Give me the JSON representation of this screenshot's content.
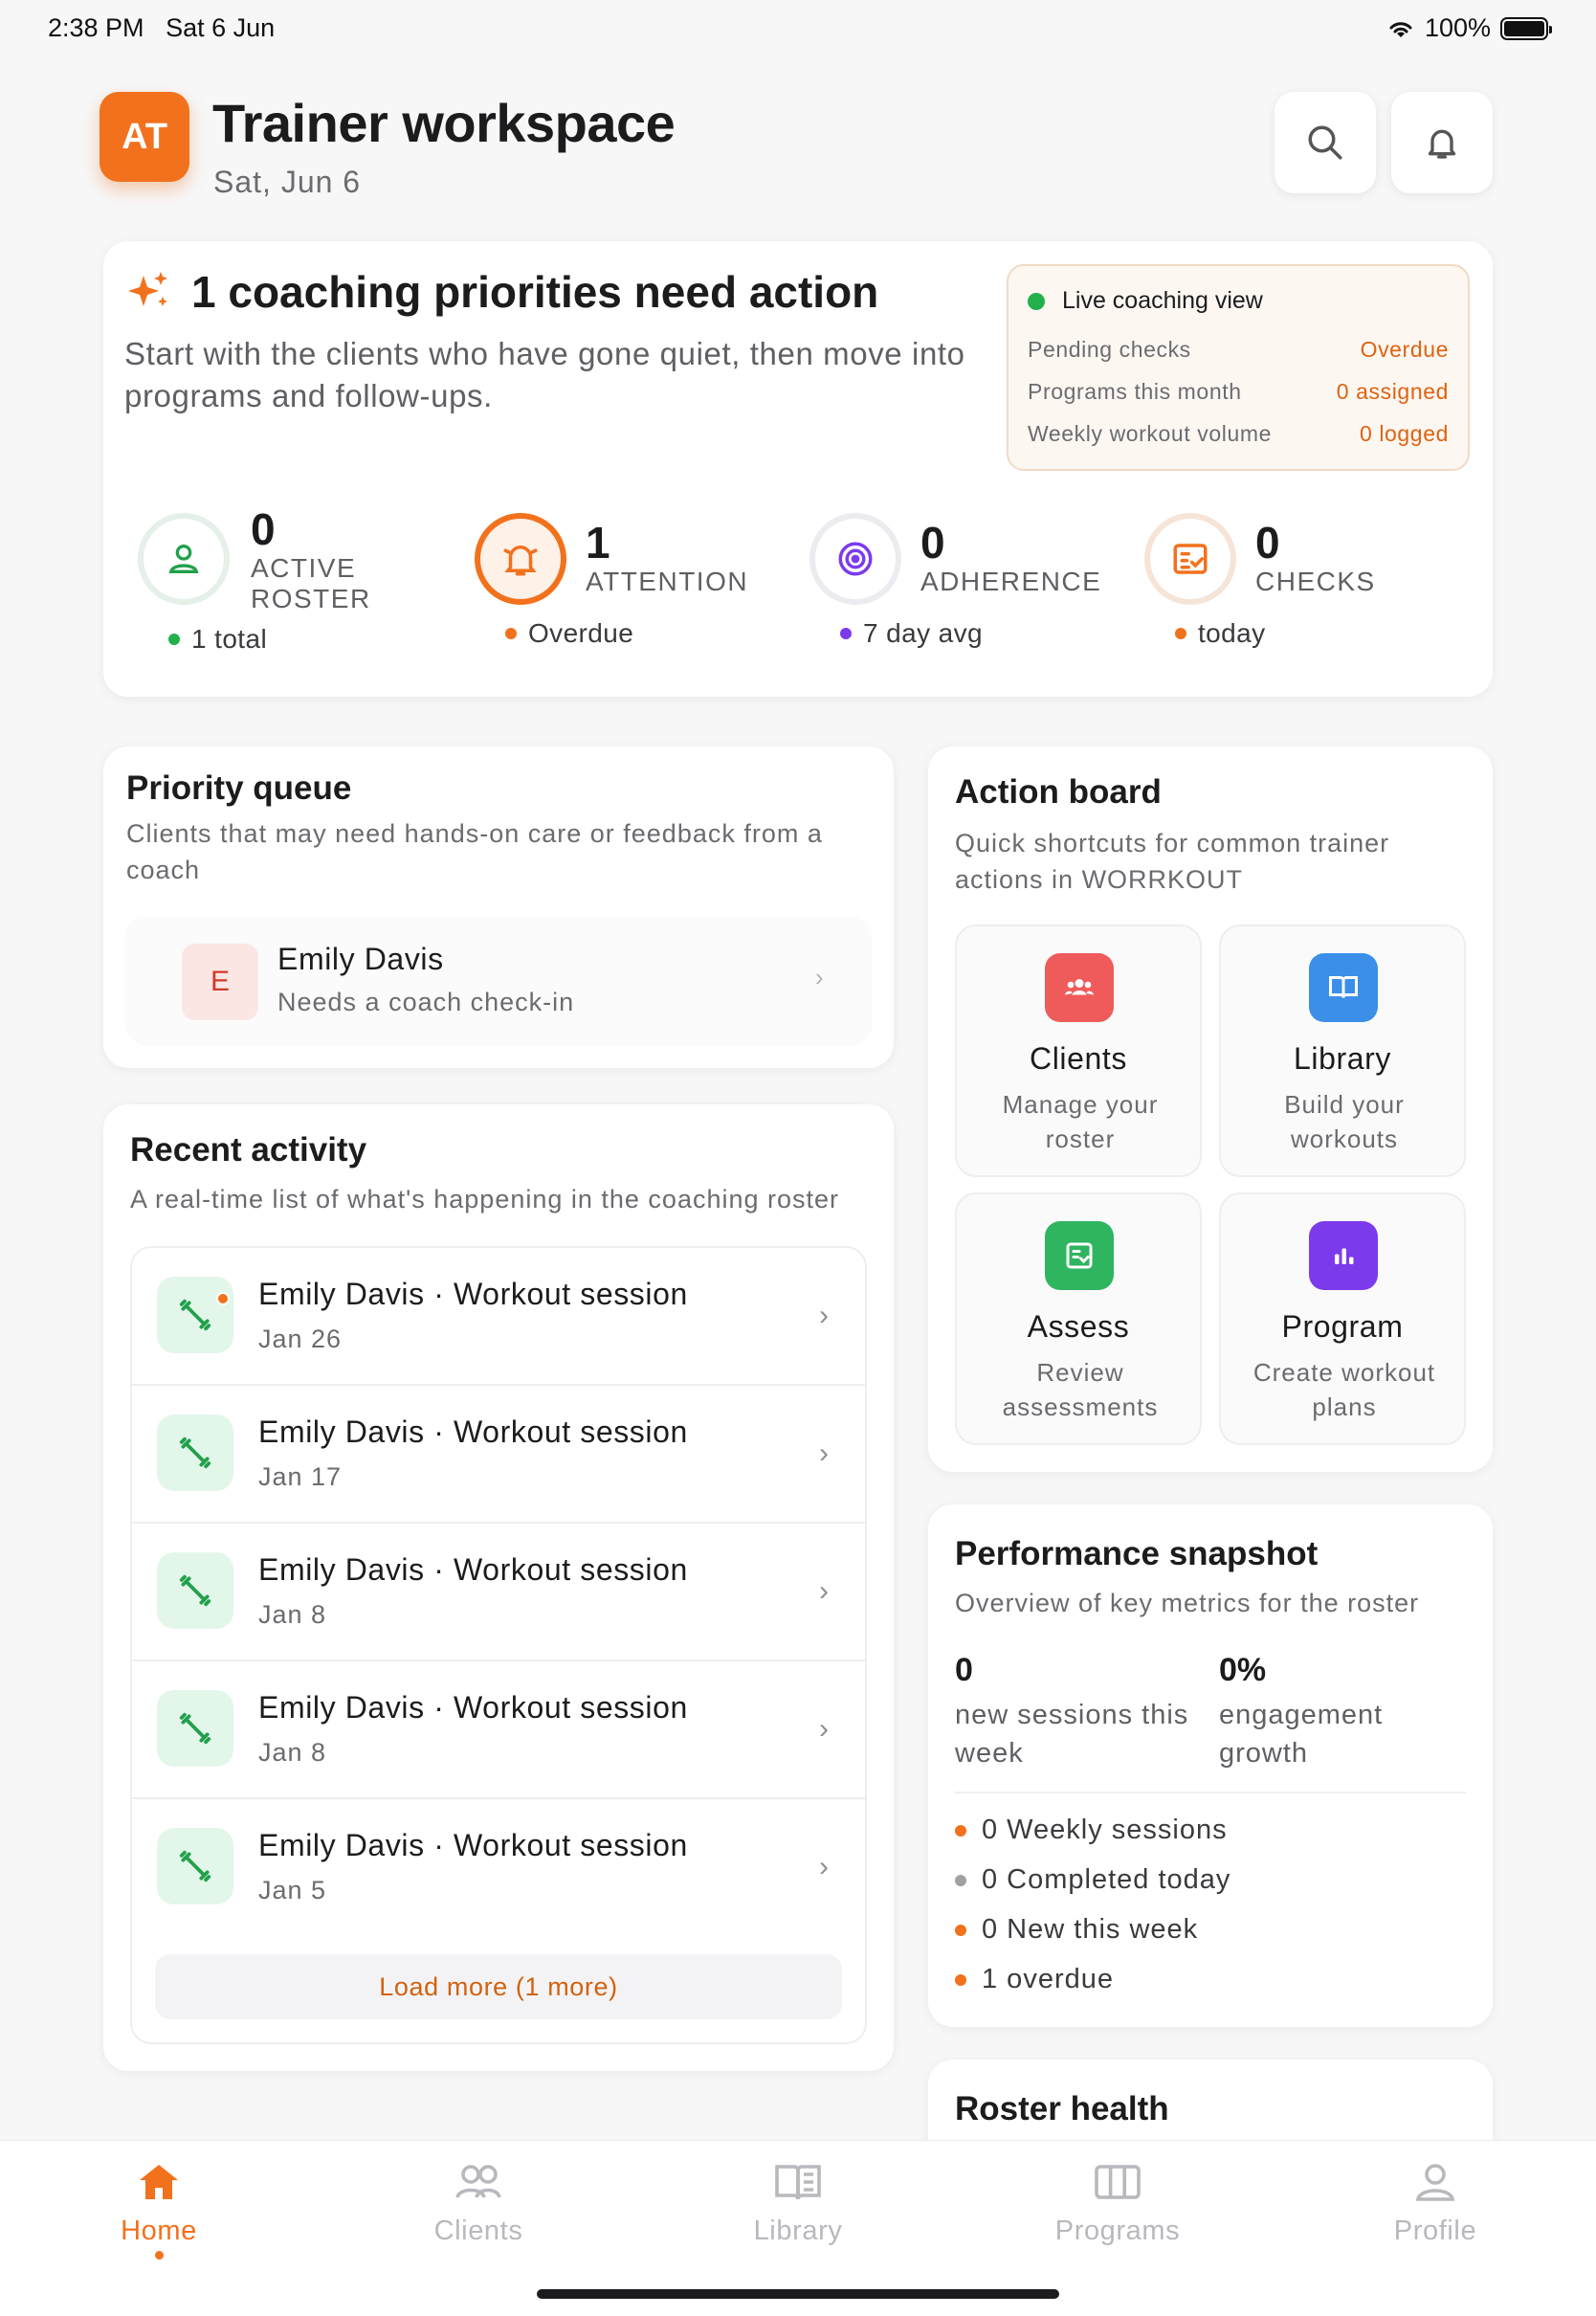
{
  "status_bar": {
    "time": "2:38 PM",
    "date": "Sat 6 Jun",
    "battery": "100%"
  },
  "header": {
    "avatar_initials": "AT",
    "title": "Trainer workspace",
    "date": "Sat, Jun 6"
  },
  "hero": {
    "title": "1 coaching priorities need action",
    "subtitle": "Start with the clients who have gone quiet, then move into programs and follow-ups.",
    "live": {
      "title": "Live coaching view",
      "rows": [
        {
          "label": "Pending checks",
          "value": "Overdue"
        },
        {
          "label": "Programs this month",
          "value": "0 assigned"
        },
        {
          "label": "Weekly workout volume",
          "value": "0 logged"
        }
      ]
    },
    "stats": [
      {
        "value": "0",
        "label_1": "ACTIVE",
        "label_2": "ROSTER",
        "foot": "1 total",
        "color": "#22b04b"
      },
      {
        "value": "1",
        "label_1": "ATTENTION",
        "label_2": "",
        "foot": "Overdue",
        "color": "#f2711c"
      },
      {
        "value": "0",
        "label_1": "ADHERENCE",
        "label_2": "",
        "foot": "7 day avg",
        "color": "#7c3aed"
      },
      {
        "value": "0",
        "label_1": "CHECKS",
        "label_2": "",
        "foot": "today",
        "color": "#f2711c"
      }
    ]
  },
  "priority_queue": {
    "title": "Priority queue",
    "subtitle": "Clients that may need hands-on care or feedback from a coach",
    "items": [
      {
        "initial": "E",
        "name": "Emily Davis",
        "note": "Needs a coach check-in"
      }
    ]
  },
  "recent_activity": {
    "title": "Recent activity",
    "subtitle": "A real-time list of what's happening in the coaching roster",
    "items": [
      {
        "title": "Emily Davis · Workout session",
        "date": "Jan 26"
      },
      {
        "title": "Emily Davis · Workout session",
        "date": "Jan 17"
      },
      {
        "title": "Emily Davis · Workout session",
        "date": "Jan 8"
      },
      {
        "title": "Emily Davis · Workout session",
        "date": "Jan 8"
      },
      {
        "title": "Emily Davis · Workout session",
        "date": "Jan 5"
      }
    ],
    "load_more": "Load more (1 more)"
  },
  "action_board": {
    "title": "Action board",
    "subtitle": "Quick shortcuts for common trainer actions in WORRKOUT",
    "tiles": [
      {
        "title": "Clients",
        "sub": "Manage your roster",
        "color": "#ef5b5b",
        "icon": "users-icon"
      },
      {
        "title": "Library",
        "sub": "Build your workouts",
        "color": "#3b8fe8",
        "icon": "book-icon"
      },
      {
        "title": "Assess",
        "sub": "Review assessments",
        "color": "#2fb560",
        "icon": "clipboard-icon"
      },
      {
        "title": "Program",
        "sub": "Create workout plans",
        "color": "#7c3aed",
        "icon": "bar-chart-icon"
      }
    ]
  },
  "performance": {
    "title": "Performance snapshot",
    "subtitle": "Overview of key metrics for the roster",
    "metrics": [
      {
        "value": "0",
        "label": "new sessions this week"
      },
      {
        "value": "0%",
        "label": "engagement growth"
      }
    ],
    "lines": [
      {
        "text": "0 Weekly sessions",
        "color": "#f2711c"
      },
      {
        "text": "0 Completed today",
        "color": "#a0a0a5"
      },
      {
        "text": "0 New this week",
        "color": "#f2711c"
      },
      {
        "text": "1 overdue",
        "color": "#f2711c"
      }
    ]
  },
  "roster_health": {
    "title": "Roster health"
  },
  "tabbar": {
    "tabs": [
      {
        "label": "Home",
        "icon": "home-icon",
        "active": true
      },
      {
        "label": "Clients",
        "icon": "users-icon"
      },
      {
        "label": "Library",
        "icon": "book-icon"
      },
      {
        "label": "Programs",
        "icon": "columns-icon"
      },
      {
        "label": "Profile",
        "icon": "person-icon"
      }
    ]
  },
  "colors": {
    "accent": "#f2711c",
    "live_dot": "#22b04b"
  }
}
